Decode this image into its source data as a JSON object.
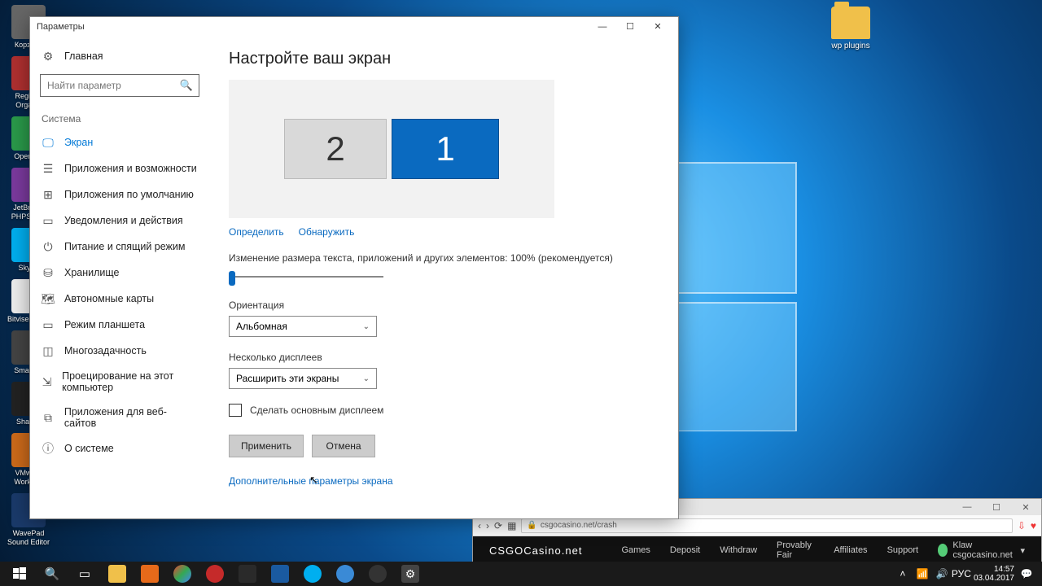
{
  "desktop_icons_left": [
    {
      "label": "Корзина",
      "c": "#666"
    },
    {
      "label": "Registry Organiz",
      "c": "#b03030"
    },
    {
      "label": "Open Se",
      "c": "#2a9a4a"
    },
    {
      "label": "JetBrains PHPStorm",
      "c": "#7b3a9e"
    },
    {
      "label": "Skype",
      "c": "#00aff0"
    },
    {
      "label": "Bitvise Client",
      "c": "#eeeeee"
    },
    {
      "label": "SmartGit",
      "c": "#444444"
    },
    {
      "label": "ShareX",
      "c": "#222222"
    },
    {
      "label": "VMware Workstat",
      "c": "#cc6a1a"
    },
    {
      "label": "WavePad Sound Editor",
      "c": "#1a3a6a"
    }
  ],
  "desktop_icon_right": "wp plugins",
  "settings": {
    "window_title": "Параметры",
    "home": "Главная",
    "search_placeholder": "Найти параметр",
    "section": "Система",
    "nav": [
      "Экран",
      "Приложения и возможности",
      "Приложения по умолчанию",
      "Уведомления и действия",
      "Питание и спящий режим",
      "Хранилище",
      "Автономные карты",
      "Режим планшета",
      "Многозадачность",
      "Проецирование на этот компьютер",
      "Приложения для веб-сайтов",
      "О системе"
    ],
    "heading": "Настройте ваш экран",
    "mon2": "2",
    "mon1": "1",
    "identify": "Определить",
    "detect": "Обнаружить",
    "scale_label": "Изменение размера текста, приложений и других элементов: 100% (рекомендуется)",
    "orientation_label": "Ориентация",
    "orientation_value": "Альбомная",
    "multiple_label": "Несколько дисплеев",
    "multiple_value": "Расширить эти экраны",
    "primary_checkbox": "Сделать основным дисплеем",
    "apply": "Применить",
    "cancel": "Отмена",
    "advanced": "Дополнительные параметры экрана"
  },
  "browser": {
    "url": "csgocasino.net/crash",
    "logo": "CSGOCasino.net",
    "menu": [
      "Games",
      "Deposit",
      "Withdraw",
      "Provably Fair",
      "Affiliates",
      "Support"
    ],
    "user": "Klaw csgocasino.net"
  },
  "taskbar": {
    "lang": "РУС",
    "time": "14:57",
    "date": "03.04.2017"
  }
}
